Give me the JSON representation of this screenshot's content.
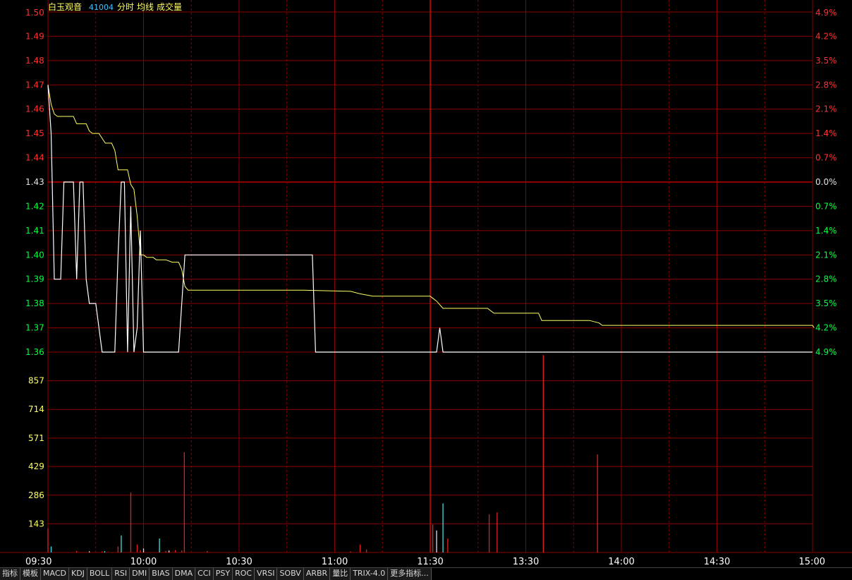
{
  "header": {
    "stock_name": "白玉观音",
    "stock_code": "41004",
    "labels": [
      "分时",
      "均线",
      "成交量"
    ]
  },
  "colors": {
    "grid": "#8b0000",
    "up": "#ff3030",
    "down": "#00ff40",
    "flat": "#e0e0e0",
    "price_line": "#ffffff",
    "avg_line": "#ffff60",
    "volume_axis": "#ffff60",
    "time_axis": "#ffffff",
    "name": "#ffff60",
    "code": "#40c0ff"
  },
  "chart_data": {
    "type": "line",
    "title": "",
    "prev_close": 1.43,
    "price_axis": {
      "ticks": [
        {
          "value": 1.5,
          "label": "1.50",
          "side": "up"
        },
        {
          "value": 1.49,
          "label": "1.49",
          "side": "up"
        },
        {
          "value": 1.48,
          "label": "1.48",
          "side": "up"
        },
        {
          "value": 1.47,
          "label": "1.47",
          "side": "up"
        },
        {
          "value": 1.46,
          "label": "1.46",
          "side": "up"
        },
        {
          "value": 1.45,
          "label": "1.45",
          "side": "up"
        },
        {
          "value": 1.44,
          "label": "1.44",
          "side": "up"
        },
        {
          "value": 1.43,
          "label": "1.43",
          "side": "flat"
        },
        {
          "value": 1.42,
          "label": "1.42",
          "side": "down"
        },
        {
          "value": 1.41,
          "label": "1.41",
          "side": "down"
        },
        {
          "value": 1.4,
          "label": "1.40",
          "side": "down"
        },
        {
          "value": 1.39,
          "label": "1.39",
          "side": "down"
        },
        {
          "value": 1.38,
          "label": "1.38",
          "side": "down"
        },
        {
          "value": 1.37,
          "label": "1.37",
          "side": "down"
        },
        {
          "value": 1.36,
          "label": "1.36",
          "side": "down"
        }
      ],
      "range": [
        1.36,
        1.5
      ]
    },
    "pct_axis": {
      "ticks": [
        {
          "value": 1.5,
          "label": "4.9%",
          "side": "up"
        },
        {
          "value": 1.49,
          "label": "4.2%",
          "side": "up"
        },
        {
          "value": 1.48,
          "label": "3.5%",
          "side": "up"
        },
        {
          "value": 1.47,
          "label": "2.8%",
          "side": "up"
        },
        {
          "value": 1.46,
          "label": "2.1%",
          "side": "up"
        },
        {
          "value": 1.45,
          "label": "1.4%",
          "side": "up"
        },
        {
          "value": 1.44,
          "label": "0.7%",
          "side": "up"
        },
        {
          "value": 1.43,
          "label": "0.0%",
          "side": "flat"
        },
        {
          "value": 1.42,
          "label": "0.7%",
          "side": "down"
        },
        {
          "value": 1.41,
          "label": "1.4%",
          "side": "down"
        },
        {
          "value": 1.4,
          "label": "2.1%",
          "side": "down"
        },
        {
          "value": 1.39,
          "label": "2.8%",
          "side": "down"
        },
        {
          "value": 1.38,
          "label": "3.5%",
          "side": "down"
        },
        {
          "value": 1.37,
          "label": "4.2%",
          "side": "down"
        },
        {
          "value": 1.36,
          "label": "4.9%",
          "side": "down"
        }
      ]
    },
    "volume_axis": {
      "ticks": [
        {
          "value": 857,
          "label": "857"
        },
        {
          "value": 714,
          "label": "714"
        },
        {
          "value": 571,
          "label": "571"
        },
        {
          "value": 429,
          "label": "429"
        },
        {
          "value": 286,
          "label": "286"
        },
        {
          "value": 143,
          "label": "143"
        }
      ],
      "range": [
        0,
        1000
      ]
    },
    "time_axis": {
      "labels": [
        {
          "minute": 0,
          "label": "09:30"
        },
        {
          "minute": 30,
          "label": "10:00"
        },
        {
          "minute": 60,
          "label": "10:30"
        },
        {
          "minute": 90,
          "label": "11:00"
        },
        {
          "minute": 120,
          "label": "11:30"
        },
        {
          "minute": 150,
          "label": "13:30"
        },
        {
          "minute": 180,
          "label": "14:00"
        },
        {
          "minute": 210,
          "label": "14:30"
        },
        {
          "minute": 240,
          "label": "15:00"
        }
      ],
      "total_minutes": 240,
      "session_break_minute": 120
    },
    "price_series": [
      [
        0,
        1.47
      ],
      [
        1,
        1.45
      ],
      [
        2,
        1.39
      ],
      [
        3,
        1.39
      ],
      [
        4,
        1.39
      ],
      [
        5,
        1.43
      ],
      [
        6,
        1.43
      ],
      [
        7,
        1.43
      ],
      [
        8,
        1.43
      ],
      [
        9,
        1.39
      ],
      [
        10,
        1.43
      ],
      [
        11,
        1.43
      ],
      [
        12,
        1.39
      ],
      [
        13,
        1.38
      ],
      [
        14,
        1.38
      ],
      [
        15,
        1.38
      ],
      [
        16,
        1.37
      ],
      [
        17,
        1.36
      ],
      [
        18,
        1.36
      ],
      [
        19,
        1.36
      ],
      [
        20,
        1.36
      ],
      [
        21,
        1.36
      ],
      [
        22,
        1.4
      ],
      [
        23,
        1.43
      ],
      [
        24,
        1.43
      ],
      [
        25,
        1.36
      ],
      [
        26,
        1.42
      ],
      [
        27,
        1.36
      ],
      [
        28,
        1.37
      ],
      [
        29,
        1.41
      ],
      [
        30,
        1.36
      ],
      [
        31,
        1.36
      ],
      [
        32,
        1.36
      ],
      [
        33,
        1.36
      ],
      [
        34,
        1.36
      ],
      [
        35,
        1.36
      ],
      [
        36,
        1.36
      ],
      [
        37,
        1.36
      ],
      [
        38,
        1.36
      ],
      [
        39,
        1.36
      ],
      [
        40,
        1.36
      ],
      [
        41,
        1.36
      ],
      [
        42,
        1.38
      ],
      [
        43,
        1.4
      ],
      [
        44,
        1.4
      ],
      [
        50,
        1.4
      ],
      [
        60,
        1.4
      ],
      [
        70,
        1.4
      ],
      [
        80,
        1.4
      ],
      [
        83,
        1.4
      ],
      [
        84,
        1.36
      ],
      [
        90,
        1.36
      ],
      [
        100,
        1.36
      ],
      [
        110,
        1.36
      ],
      [
        120,
        1.36
      ],
      [
        121,
        1.36
      ],
      [
        122,
        1.36
      ],
      [
        123,
        1.37
      ],
      [
        124,
        1.36
      ],
      [
        130,
        1.36
      ],
      [
        140,
        1.36
      ],
      [
        150,
        1.36
      ],
      [
        160,
        1.36
      ],
      [
        170,
        1.36
      ],
      [
        180,
        1.36
      ],
      [
        190,
        1.36
      ],
      [
        200,
        1.36
      ],
      [
        210,
        1.36
      ],
      [
        220,
        1.36
      ],
      [
        230,
        1.36
      ],
      [
        240,
        1.36
      ]
    ],
    "avg_series": [
      [
        0,
        1.47
      ],
      [
        1,
        1.462
      ],
      [
        2,
        1.458
      ],
      [
        3,
        1.457
      ],
      [
        8,
        1.457
      ],
      [
        9,
        1.454
      ],
      [
        12,
        1.454
      ],
      [
        13,
        1.451
      ],
      [
        14,
        1.45
      ],
      [
        16,
        1.45
      ],
      [
        17,
        1.448
      ],
      [
        18,
        1.446
      ],
      [
        20,
        1.446
      ],
      [
        21,
        1.443
      ],
      [
        22,
        1.435
      ],
      [
        25,
        1.435
      ],
      [
        26,
        1.429
      ],
      [
        27,
        1.427
      ],
      [
        28,
        1.416
      ],
      [
        29,
        1.4
      ],
      [
        30,
        1.4
      ],
      [
        31,
        1.399
      ],
      [
        33,
        1.399
      ],
      [
        34,
        1.398
      ],
      [
        37,
        1.398
      ],
      [
        39,
        1.397
      ],
      [
        41,
        1.397
      ],
      [
        42,
        1.394
      ],
      [
        43,
        1.387
      ],
      [
        44,
        1.3855
      ],
      [
        80,
        1.3855
      ],
      [
        95,
        1.385
      ],
      [
        98,
        1.384
      ],
      [
        102,
        1.383
      ],
      [
        120,
        1.383
      ],
      [
        121,
        1.382
      ],
      [
        122,
        1.381
      ],
      [
        124,
        1.378
      ],
      [
        130,
        1.378
      ],
      [
        138,
        1.378
      ],
      [
        140,
        1.376
      ],
      [
        150,
        1.376
      ],
      [
        154,
        1.376
      ],
      [
        155,
        1.373
      ],
      [
        170,
        1.373
      ],
      [
        173,
        1.372
      ],
      [
        174,
        1.371
      ],
      [
        240,
        1.371
      ],
      [
        240.5,
        1.37
      ]
    ],
    "volume_series": [
      {
        "minute": 0,
        "value": 120,
        "color": "red"
      },
      {
        "minute": 1,
        "value": 30,
        "color": "cyan"
      },
      {
        "minute": 9,
        "value": 8,
        "color": "red"
      },
      {
        "minute": 13,
        "value": 6,
        "color": "white"
      },
      {
        "minute": 17,
        "value": 5,
        "color": "red"
      },
      {
        "minute": 17.8,
        "value": 7,
        "color": "cyan"
      },
      {
        "minute": 23,
        "value": 85,
        "color": "cyan"
      },
      {
        "minute": 22,
        "value": 30,
        "color": "red"
      },
      {
        "minute": 26,
        "value": 300,
        "color": "red"
      },
      {
        "minute": 28,
        "value": 40,
        "color": "red"
      },
      {
        "minute": 29,
        "value": 12,
        "color": "red"
      },
      {
        "minute": 30,
        "value": 20,
        "color": "white"
      },
      {
        "minute": 35,
        "value": 70,
        "color": "cyan"
      },
      {
        "minute": 37,
        "value": 8,
        "color": "red"
      },
      {
        "minute": 38,
        "value": 10,
        "color": "white"
      },
      {
        "minute": 40,
        "value": 12,
        "color": "red"
      },
      {
        "minute": 42,
        "value": 10,
        "color": "red"
      },
      {
        "minute": 50,
        "value": 8,
        "color": "red"
      },
      {
        "minute": 42.8,
        "value": 500,
        "color": "red"
      },
      {
        "minute": 95,
        "value": 5,
        "color": "red"
      },
      {
        "minute": 98,
        "value": 40,
        "color": "red"
      },
      {
        "minute": 100,
        "value": 15,
        "color": "red"
      },
      {
        "minute": 120.8,
        "value": 140,
        "color": "red"
      },
      {
        "minute": 122,
        "value": 110,
        "color": "white"
      },
      {
        "minute": 124,
        "value": 245,
        "color": "cyan"
      },
      {
        "minute": 125.5,
        "value": 70,
        "color": "red"
      },
      {
        "minute": 138.5,
        "value": 190,
        "color": "red"
      },
      {
        "minute": 141,
        "value": 200,
        "color": "red"
      },
      {
        "minute": 155.5,
        "value": 985,
        "color": "red"
      },
      {
        "minute": 172.5,
        "value": 490,
        "color": "red"
      }
    ]
  },
  "toolbar": {
    "items": [
      "指标",
      "模板",
      "MACD",
      "KDJ",
      "BOLL",
      "RSI",
      "DMI",
      "BIAS",
      "DMA",
      "CCI",
      "PSY",
      "ROC",
      "VRSI",
      "SOBV",
      "ARBR",
      "量比",
      "TRIX-4.0",
      "更多指标..."
    ]
  }
}
